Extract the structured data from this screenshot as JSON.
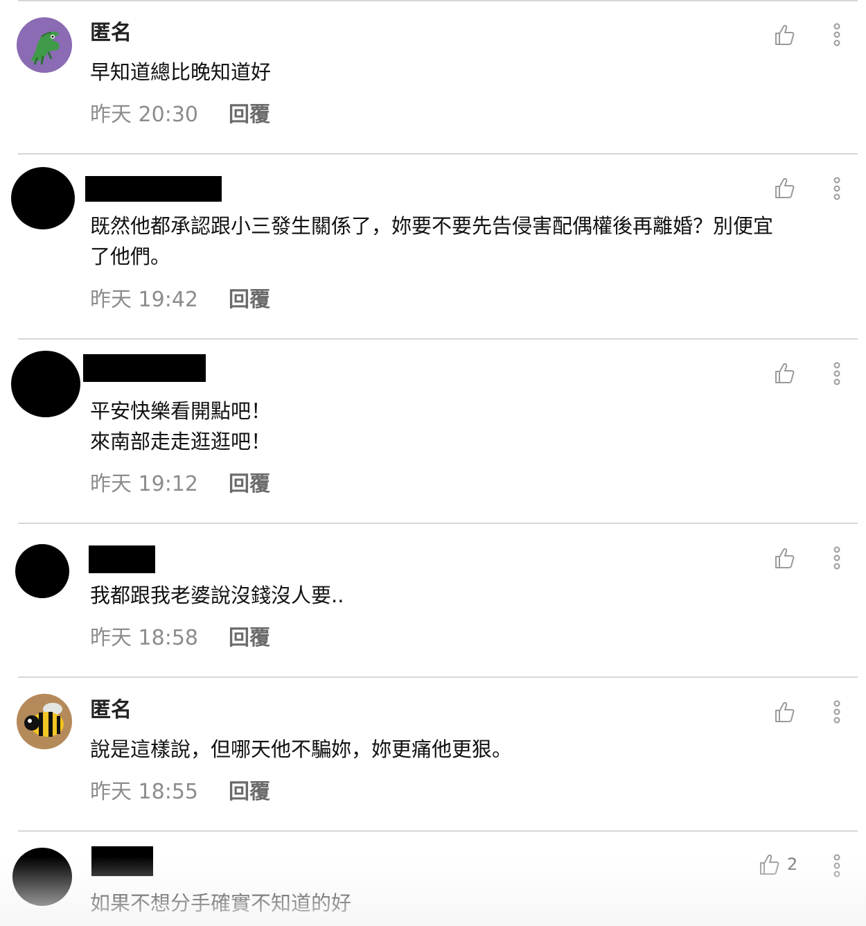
{
  "comments": [
    {
      "name": "匿名",
      "avatar": "crocodile-avatar",
      "text": "早知道總比晚知道好",
      "time": "昨天 20:30",
      "reply": "回覆",
      "likes": ""
    },
    {
      "name": "",
      "avatar": "redacted-avatar",
      "text": "既然他都承認跟小三發生關係了，妳要不要先告侵害配偶權後再離婚？別便宜\n了他們。",
      "time": "昨天 19:42",
      "reply": "回覆",
      "likes": ""
    },
    {
      "name": "",
      "avatar": "redacted-avatar",
      "text": "平安快樂看開點吧！\n來南部走走逛逛吧！",
      "time": "昨天 19:12",
      "reply": "回覆",
      "likes": ""
    },
    {
      "name": "",
      "avatar": "redacted-avatar",
      "text": "我都跟我老婆說沒錢沒人要..",
      "time": "昨天 18:58",
      "reply": "回覆",
      "likes": ""
    },
    {
      "name": "匿名",
      "avatar": "bee-avatar",
      "text": "說是這樣說，但哪天他不騙妳，妳更痛他更狠。",
      "time": "昨天 18:55",
      "reply": "回覆",
      "likes": ""
    },
    {
      "name": "",
      "avatar": "redacted-avatar",
      "text": "如果不想分手確實不知道的好",
      "time": "",
      "reply": "",
      "likes": "2"
    }
  ],
  "icons": {
    "like": "thumbs-up-icon",
    "more": "more-vertical-icon"
  },
  "colors": {
    "divider": "#d6d6d6",
    "meta": "#8c8c8c",
    "reply": "#6b6b6b",
    "icon": "#9a9a9a"
  }
}
